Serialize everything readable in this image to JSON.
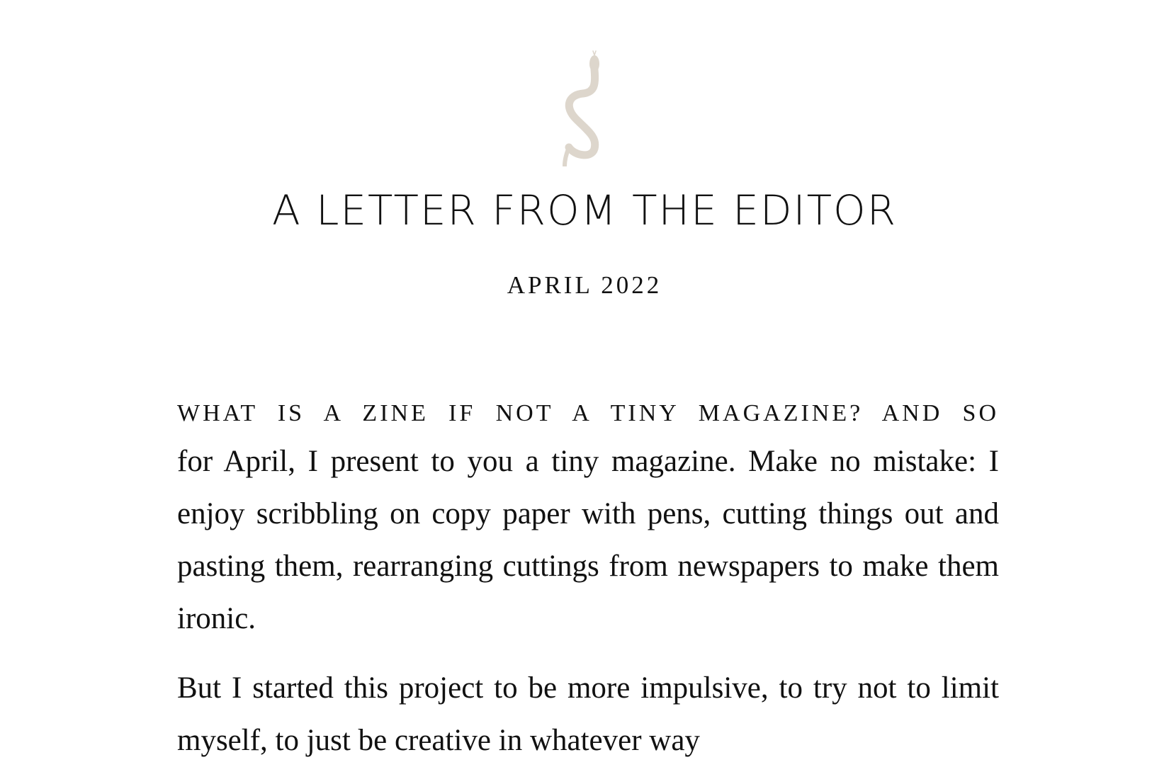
{
  "header": {
    "logo_icon": "snake-icon",
    "logo_color": "#ddd6cc",
    "title": "A LETTER FROM THE EDITOR",
    "date": "APRIL 2022"
  },
  "article": {
    "lead_in": "WHAT IS A ZINE IF NOT A TINY MAGAZINE? AND SO",
    "paragraph_1": "for April, I present to you a tiny magazine. Make no mistake: I enjoy scribbling on copy paper with pens, cutting things out and pasting them, rearranging cuttings from newspapers to make them ironic.",
    "paragraph_2": "But I started this project to be more impulsive, to try not to limit myself, to just be creative in whatever way"
  }
}
